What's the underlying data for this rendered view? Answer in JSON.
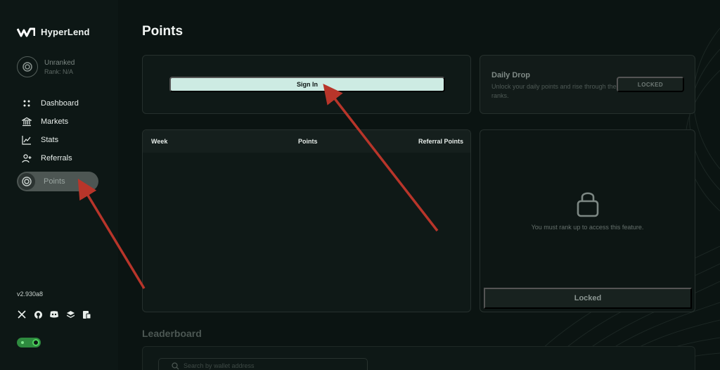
{
  "app": {
    "name": "HyperLend"
  },
  "rank": {
    "title": "Unranked",
    "subtitle": "Rank: N/A"
  },
  "nav": {
    "items": [
      {
        "label": "Dashboard",
        "icon": "grid-dots-icon"
      },
      {
        "label": "Markets",
        "icon": "bank-icon"
      },
      {
        "label": "Stats",
        "icon": "chart-icon"
      },
      {
        "label": "Referrals",
        "icon": "user-plus-icon"
      },
      {
        "label": "Points",
        "icon": "target-icon",
        "active": true
      }
    ]
  },
  "version": "v2.930a8",
  "socials": [
    "x-icon",
    "github-icon",
    "discord-icon",
    "layers-icon",
    "docs-icon"
  ],
  "page": {
    "title": "Points"
  },
  "signin": {
    "label": "Sign In"
  },
  "daily_drop": {
    "title": "Daily Drop",
    "description": "Unlock your daily points and rise through the ranks.",
    "button": "LOCKED"
  },
  "table": {
    "columns": [
      "Week",
      "Points",
      "Referral Points"
    ]
  },
  "lock_panel": {
    "message": "You must rank up to access this feature.",
    "button": "Locked"
  },
  "leaderboard": {
    "title": "Leaderboard",
    "search_placeholder": "Search by wallet address"
  },
  "colors": {
    "accent": "#cdebe3",
    "toggle": "#2e8b3f",
    "annotation_arrow": "#c0392b"
  }
}
